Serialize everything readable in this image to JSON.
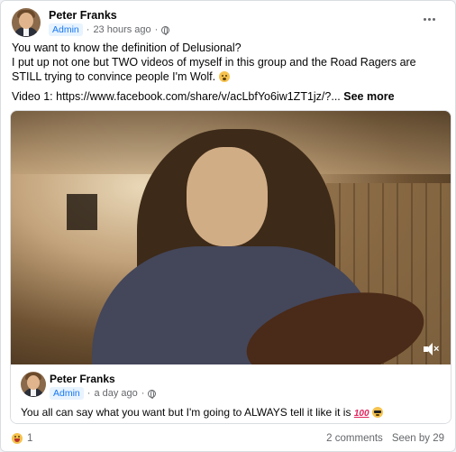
{
  "post": {
    "author": "Peter Franks",
    "badge": "Admin",
    "time": "23 hours ago",
    "separator": "·",
    "line1": "You want to know the definition of Delusional?",
    "line2": "I put up not one but TWO videos of myself in this group and the Road Ragers are STILL trying to convince people I'm Wolf.",
    "line3_prefix": "Video 1: https://www.facebook.com/share/v/acLbfYo6iw1ZT1jz/?...",
    "see_more": "See more"
  },
  "shared": {
    "author": "Peter Franks",
    "badge": "Admin",
    "time": "a day ago",
    "separator": "·",
    "text": "You all can say what you want but I'm going to ALWAYS tell it like it is",
    "emoji_100": "100"
  },
  "footer": {
    "reaction_count": "1",
    "comments": "2 comments",
    "seen": "Seen by 29"
  },
  "icons": {
    "more": "more-options-icon",
    "privacy": "globe-icon",
    "mute": "volume-muted-icon"
  }
}
